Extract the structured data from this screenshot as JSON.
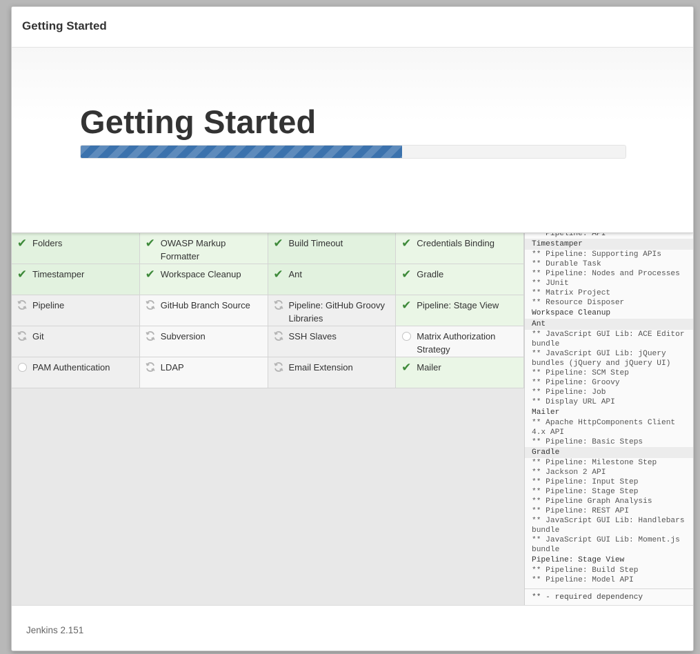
{
  "dialog": {
    "title": "Getting Started"
  },
  "hero": {
    "heading": "Getting Started",
    "progress_fraction": 0.59
  },
  "plugins": [
    {
      "name": "Folders",
      "status": "done"
    },
    {
      "name": "OWASP Markup Formatter",
      "status": "done"
    },
    {
      "name": "Build Timeout",
      "status": "done"
    },
    {
      "name": "Credentials Binding",
      "status": "done"
    },
    {
      "name": "Timestamper",
      "status": "done"
    },
    {
      "name": "Workspace Cleanup",
      "status": "done"
    },
    {
      "name": "Ant",
      "status": "done"
    },
    {
      "name": "Gradle",
      "status": "done"
    },
    {
      "name": "Pipeline",
      "status": "installing"
    },
    {
      "name": "GitHub Branch Source",
      "status": "installing"
    },
    {
      "name": "Pipeline: GitHub Groovy Libraries",
      "status": "installing"
    },
    {
      "name": "Pipeline: Stage View",
      "status": "done"
    },
    {
      "name": "Git",
      "status": "installing"
    },
    {
      "name": "Subversion",
      "status": "installing"
    },
    {
      "name": "SSH Slaves",
      "status": "installing"
    },
    {
      "name": "Matrix Authorization Strategy",
      "status": "pending"
    },
    {
      "name": "PAM Authentication",
      "status": "pending"
    },
    {
      "name": "LDAP",
      "status": "installing"
    },
    {
      "name": "Email Extension",
      "status": "installing"
    },
    {
      "name": "Mailer",
      "status": "done"
    }
  ],
  "icons": {
    "done": "check-icon",
    "installing": "refresh-icon",
    "pending": "circle-icon"
  },
  "log": {
    "lines": [
      {
        "text": "** Pipeline: API",
        "kind": "dep"
      },
      {
        "text": "Timestamper",
        "kind": "head",
        "shade": true
      },
      {
        "text": "** Pipeline: Supporting APIs",
        "kind": "dep"
      },
      {
        "text": "** Durable Task",
        "kind": "dep"
      },
      {
        "text": "** Pipeline: Nodes and Processes",
        "kind": "dep"
      },
      {
        "text": "** JUnit",
        "kind": "dep"
      },
      {
        "text": "** Matrix Project",
        "kind": "dep"
      },
      {
        "text": "** Resource Disposer",
        "kind": "dep"
      },
      {
        "text": "Workspace Cleanup",
        "kind": "head",
        "shade": false
      },
      {
        "text": "Ant",
        "kind": "head",
        "shade": true
      },
      {
        "text": "** JavaScript GUI Lib: ACE Editor bundle",
        "kind": "dep"
      },
      {
        "text": "** JavaScript GUI Lib: jQuery bundles (jQuery and jQuery UI)",
        "kind": "dep"
      },
      {
        "text": "** Pipeline: SCM Step",
        "kind": "dep"
      },
      {
        "text": "** Pipeline: Groovy",
        "kind": "dep"
      },
      {
        "text": "** Pipeline: Job",
        "kind": "dep"
      },
      {
        "text": "** Display URL API",
        "kind": "dep"
      },
      {
        "text": "Mailer",
        "kind": "head",
        "shade": false
      },
      {
        "text": "** Apache HttpComponents Client 4.x API",
        "kind": "dep"
      },
      {
        "text": "** Pipeline: Basic Steps",
        "kind": "dep"
      },
      {
        "text": "Gradle",
        "kind": "head",
        "shade": true
      },
      {
        "text": "** Pipeline: Milestone Step",
        "kind": "dep"
      },
      {
        "text": "** Jackson 2 API",
        "kind": "dep"
      },
      {
        "text": "** Pipeline: Input Step",
        "kind": "dep"
      },
      {
        "text": "** Pipeline: Stage Step",
        "kind": "dep"
      },
      {
        "text": "** Pipeline Graph Analysis",
        "kind": "dep"
      },
      {
        "text": "** Pipeline: REST API",
        "kind": "dep"
      },
      {
        "text": "** JavaScript GUI Lib: Handlebars bundle",
        "kind": "dep"
      },
      {
        "text": "** JavaScript GUI Lib: Moment.js bundle",
        "kind": "dep"
      },
      {
        "text": "Pipeline: Stage View",
        "kind": "head",
        "shade": false
      },
      {
        "text": "** Pipeline: Build Step",
        "kind": "dep"
      },
      {
        "text": "** Pipeline: Model API",
        "kind": "dep"
      }
    ],
    "footer": "** - required dependency"
  },
  "footer": {
    "version": "Jenkins 2.151"
  }
}
